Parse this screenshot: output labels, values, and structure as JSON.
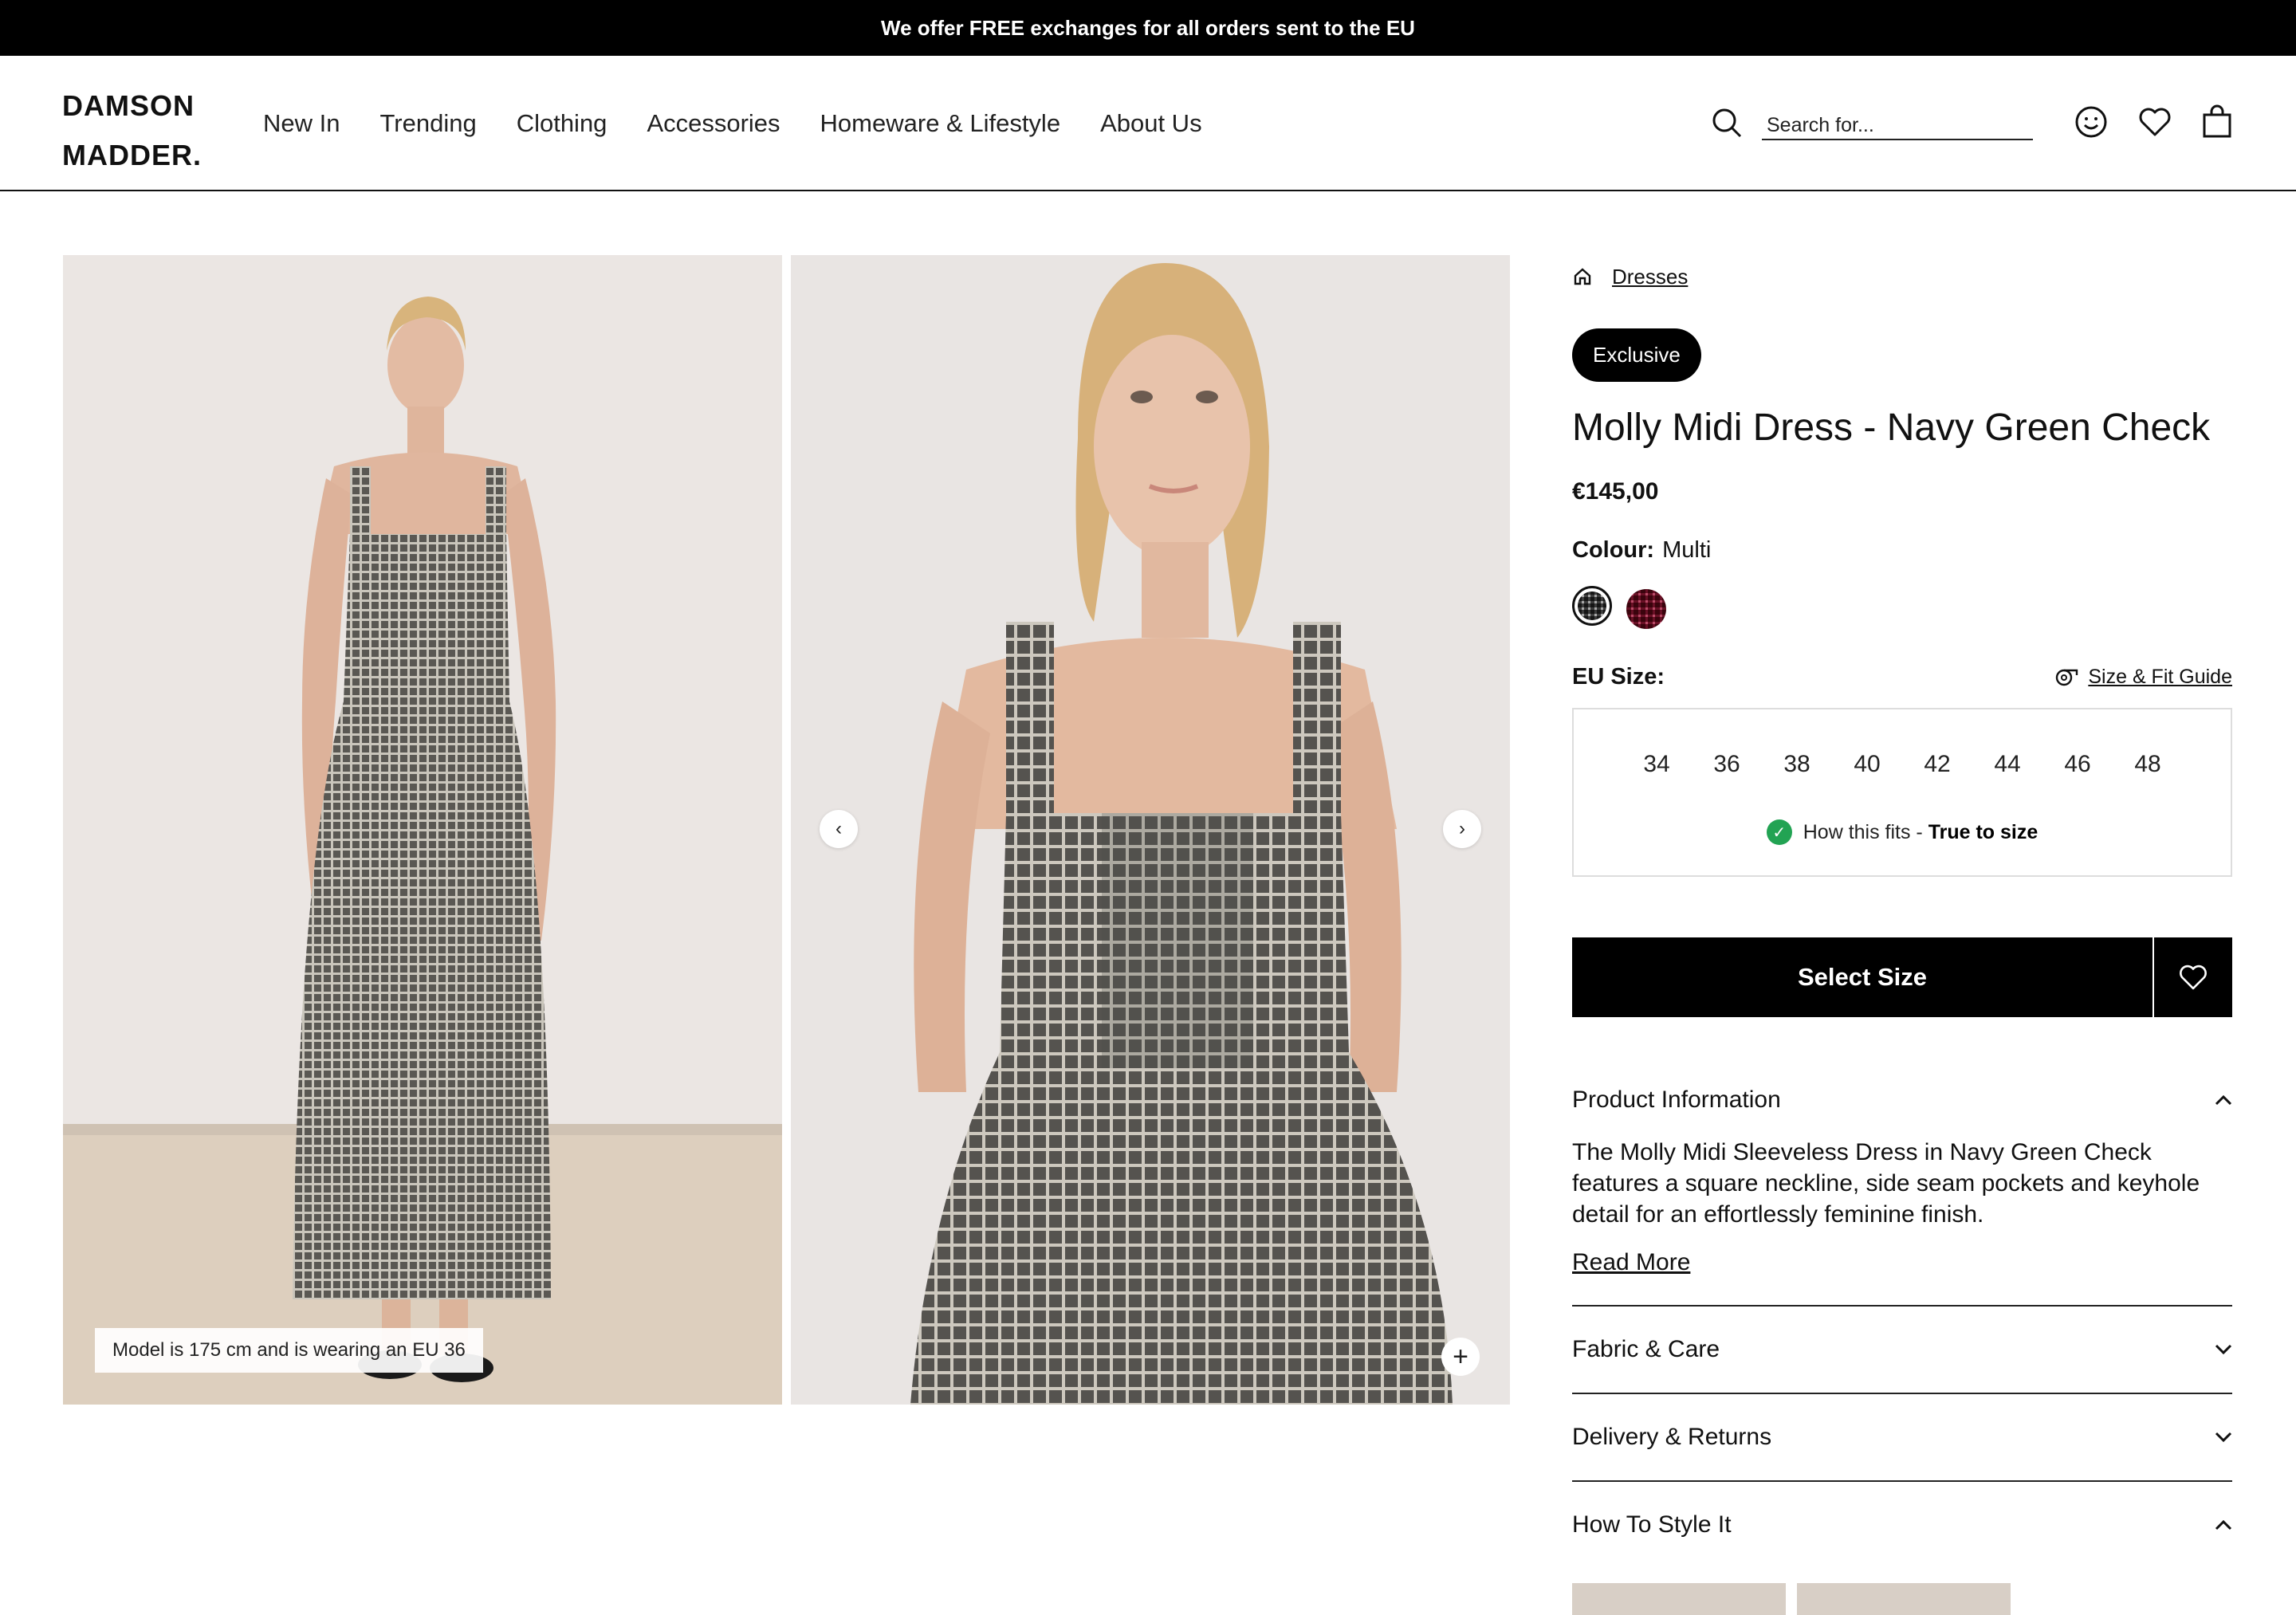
{
  "announcement": "We offer FREE exchanges for all orders sent to the EU",
  "logo": {
    "line1": "DAMSON",
    "line2": "MADDER."
  },
  "nav": {
    "items": [
      "New In",
      "Trending",
      "Clothing",
      "Accessories",
      "Homeware & Lifestyle",
      "About Us"
    ]
  },
  "search": {
    "placeholder": "Search for..."
  },
  "header_icons": [
    "search-icon",
    "account-icon",
    "wishlist-heart-icon",
    "bag-icon"
  ],
  "gallery": {
    "caption": "Model is 175 cm and is wearing an EU 36",
    "prev_arrow": "‹",
    "next_arrow": "›",
    "zoom": "+"
  },
  "product": {
    "breadcrumb": "Dresses",
    "badge": "Exclusive",
    "title": "Molly Midi Dress - Navy Green Check",
    "price": "€145,00",
    "colour_label": "Colour:",
    "colour_value": "Multi",
    "size_label": "EU Size:",
    "size_guide": "Size & Fit Guide",
    "sizes": [
      "34",
      "36",
      "38",
      "40",
      "42",
      "44",
      "46",
      "48"
    ],
    "fit_prefix": "How this fits - ",
    "fit_value": "True to size",
    "cta": "Select Size"
  },
  "accordion": {
    "product_info": {
      "label": "Product Information",
      "text": "The Molly Midi Sleeveless Dress in Navy Green Check features a square neckline, side seam pockets and keyhole detail for an effortlessly feminine finish.",
      "read_more": "Read More"
    },
    "fabric": "Fabric & Care",
    "delivery": "Delivery & Returns",
    "style": "How To Style It"
  },
  "colors": {
    "accent": "#000000",
    "fit_ok": "#22a353"
  }
}
